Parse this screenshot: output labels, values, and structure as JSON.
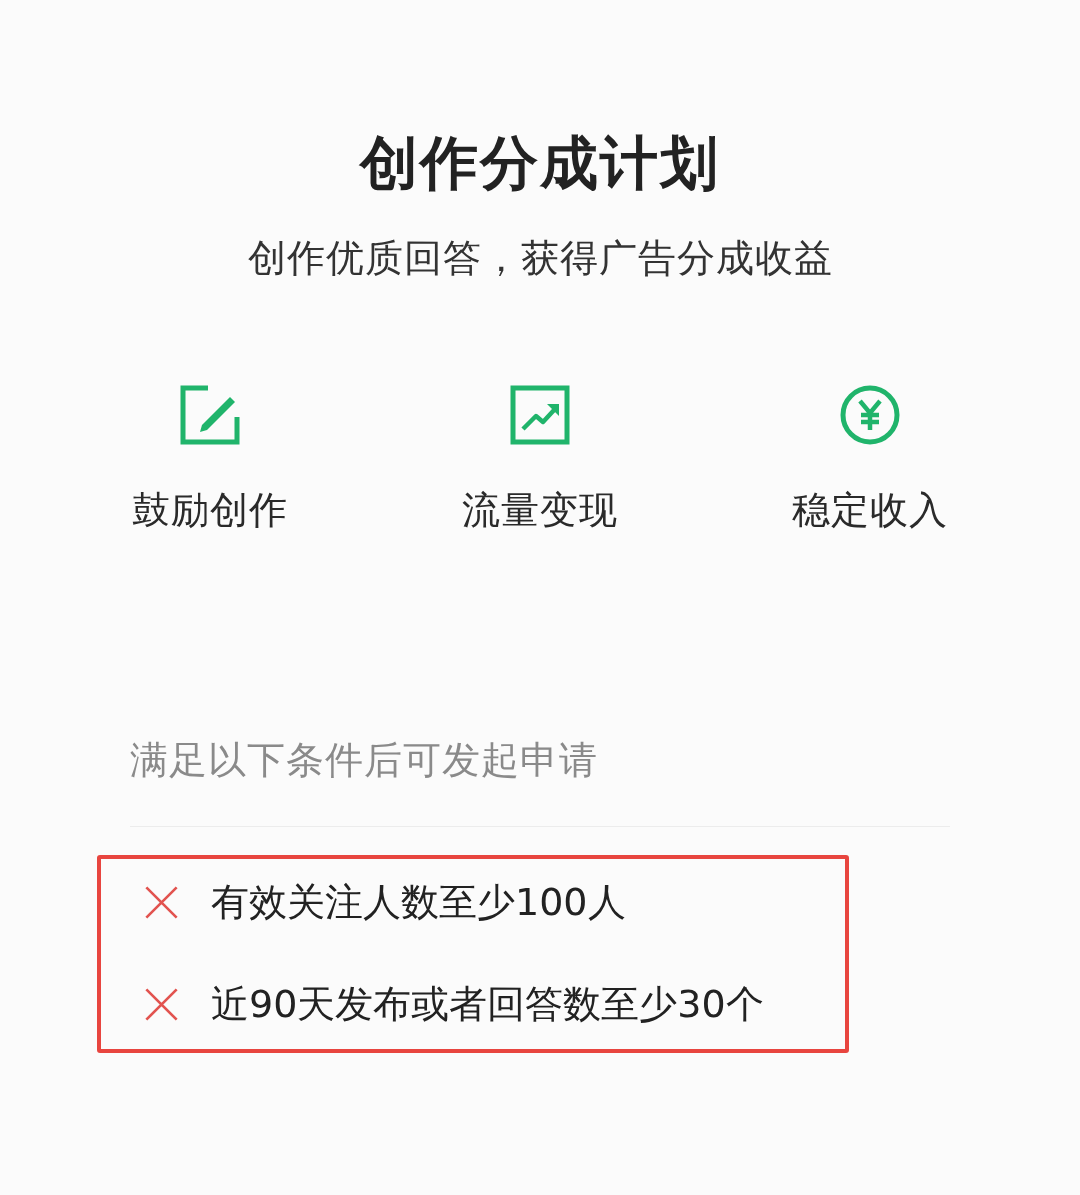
{
  "title": "创作分成计划",
  "subtitle": "创作优质回答，获得广告分成收益",
  "features": [
    {
      "label": "鼓励创作"
    },
    {
      "label": "流量变现"
    },
    {
      "label": "稳定收入"
    }
  ],
  "conditions_heading": "满足以下条件后可发起申请",
  "requirements": {
    "highlighted": true,
    "items": [
      {
        "text": "有效关注人数至少100人",
        "met": false
      },
      {
        "text": "近90天发布或者回答数至少30个",
        "met": false
      }
    ]
  }
}
